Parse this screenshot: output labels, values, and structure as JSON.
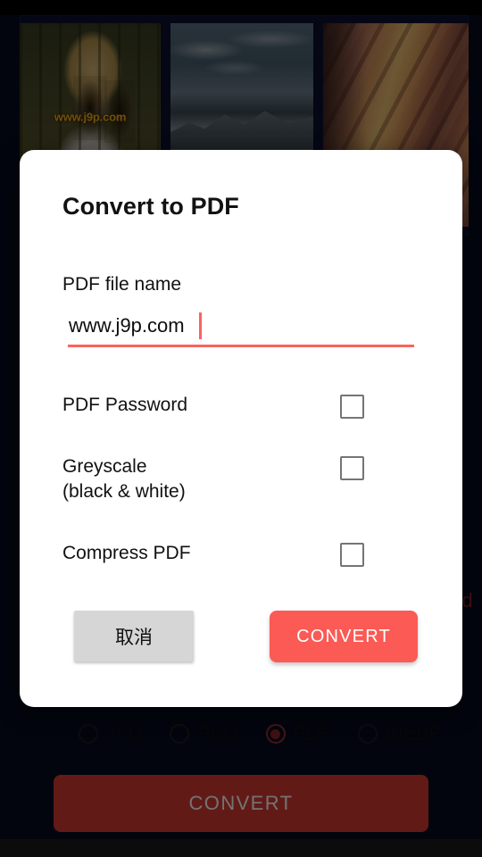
{
  "app": {
    "gallery": {
      "thumbnails": [
        {
          "name": "woman-in-field-photo",
          "watermark": "www.j9p.com"
        },
        {
          "name": "mountain-lake-photo",
          "watermark": ""
        },
        {
          "name": "slot-canyon-photo",
          "watermark": ""
        }
      ]
    },
    "ghost_text": "d",
    "format_options": [
      {
        "label": "JPG",
        "selected": false
      },
      {
        "label": "PNG",
        "selected": false
      },
      {
        "label": "PDF",
        "selected": true
      },
      {
        "label": "WEBP",
        "selected": false
      }
    ],
    "convert_button_label": "CONVERT"
  },
  "dialog": {
    "title": "Convert to PDF",
    "filename": {
      "label": "PDF file name",
      "value": "www.j9p.com",
      "placeholder": "PDF file name"
    },
    "options": [
      {
        "label": "PDF Password",
        "checked": false
      },
      {
        "label": "Greyscale\n(black & white)",
        "line1": "Greyscale",
        "line2": "(black & white)",
        "checked": false
      },
      {
        "label": "Compress PDF",
        "checked": false
      }
    ],
    "cancel_label": "取消",
    "convert_label": "CONVERT"
  },
  "colors": {
    "accent_red": "#fb5a55",
    "underline_red": "#f9635c",
    "cancel_grey": "#d6d6d6",
    "checkbox_grey": "#757575",
    "dialog_bg": "#ffffff",
    "app_bg": "#0d1130",
    "scrim": "rgba(0,0,0,0.55)",
    "watermark_gold": "#f0b429"
  }
}
